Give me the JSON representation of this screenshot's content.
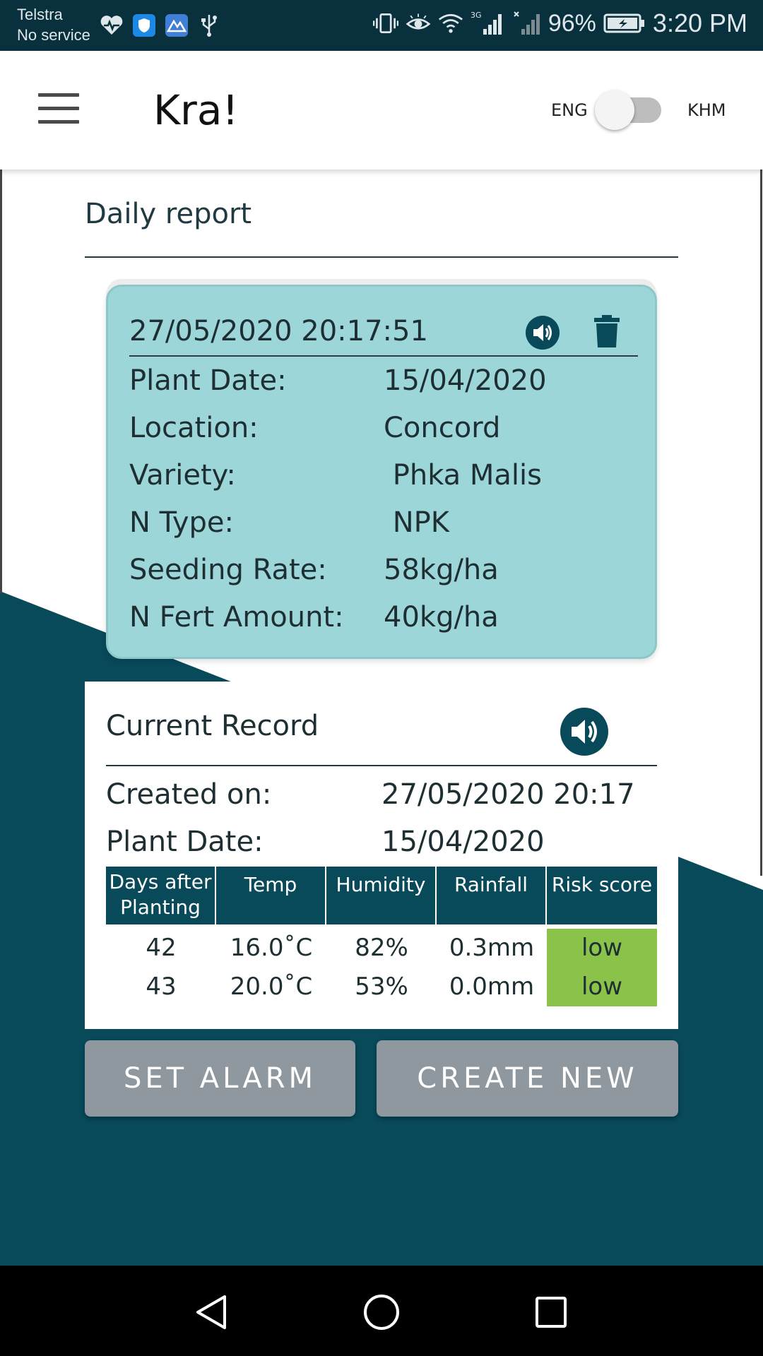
{
  "status_bar": {
    "carrier": "Telstra",
    "service": "No service",
    "network_type": "3G",
    "battery": "96%",
    "time": "3:20 PM"
  },
  "app_bar": {
    "title": "Kra!",
    "lang_left": "ENG",
    "lang_right": "KHM"
  },
  "daily_report": {
    "title": "Daily report",
    "card": {
      "timestamp": "27/05/2020 20:17:51",
      "rows": [
        {
          "label": "Plant Date:",
          "value": "15/04/2020"
        },
        {
          "label": "Location:",
          "value": "Concord"
        },
        {
          "label": "Variety:",
          "value": " Phka Malis"
        },
        {
          "label": "N Type:",
          "value": " NPK"
        },
        {
          "label": "Seeding Rate:",
          "value": "58kg/ha"
        },
        {
          "label": "N Fert Amount:",
          "value": "40kg/ha"
        }
      ]
    }
  },
  "current_record": {
    "title": "Current Record",
    "created_label": "Created on:",
    "created_value": "27/05/2020 20:17",
    "plant_label": "Plant Date:",
    "plant_value": "15/04/2020",
    "table": {
      "headers": [
        "Days after Planting",
        "Temp",
        "Humidity",
        "Rainfall",
        "Risk score"
      ],
      "rows": [
        [
          "42",
          "16.0˚C",
          "82%",
          "0.3mm",
          "low"
        ],
        [
          "43",
          "20.0˚C",
          "53%",
          "0.0mm",
          "low"
        ]
      ]
    }
  },
  "buttons": {
    "set_alarm": "SET ALARM",
    "create_new": "CREATE NEW"
  },
  "colors": {
    "status_bar": "#08303d",
    "accent_dark": "#08495a",
    "card_teal": "#9cd6d8",
    "risk_low": "#8bc34a",
    "button_grey": "#8f989f"
  }
}
